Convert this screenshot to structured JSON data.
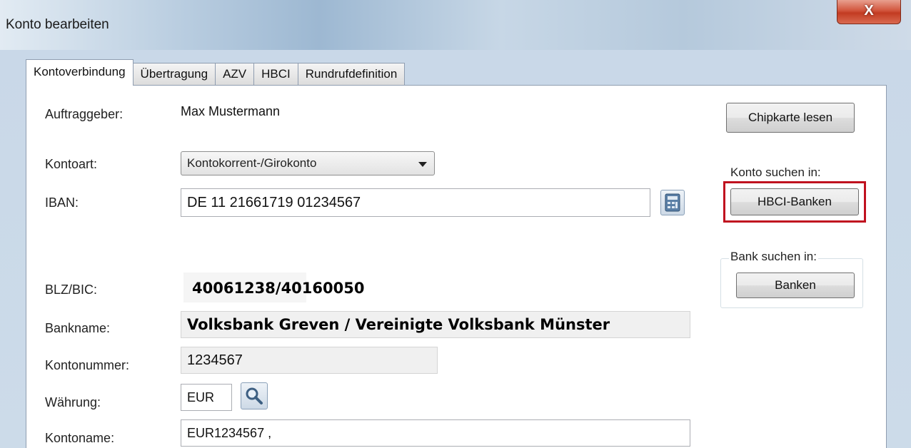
{
  "window": {
    "title": "Konto bearbeiten",
    "close_label": "X"
  },
  "tabs": [
    {
      "label": "Kontoverbindung",
      "active": true
    },
    {
      "label": "Übertragung",
      "active": false
    },
    {
      "label": "AZV",
      "active": false
    },
    {
      "label": "HBCI",
      "active": false
    },
    {
      "label": "Rundrufdefinition",
      "active": false
    }
  ],
  "form": {
    "auftraggeber_label": "Auftraggeber:",
    "auftraggeber_value": "Max Mustermann",
    "kontoart_label": "Kontoart:",
    "kontoart_value": "Kontokorrent-/Girokonto",
    "iban_label": "IBAN:",
    "iban_value": "DE 11 21661719 01234567",
    "blz_label": "BLZ/BIC:",
    "blz_value": "40061238/40160050",
    "bankname_label": "Bankname:",
    "bankname_value": "Volksbank Greven / Vereinigte Volksbank Münster",
    "kontonummer_label": "Kontonummer:",
    "kontonummer_value": "1234567",
    "waehrung_label": "Währung:",
    "waehrung_value": "EUR",
    "kontoname_label": "Kontoname:",
    "kontoname_value": "EUR1234567 ,"
  },
  "side": {
    "chipkarte_label": "Chipkarte lesen",
    "konto_suchen_label": "Konto suchen in:",
    "hbci_banken_label": "HBCI-Banken",
    "bank_suchen_label": "Bank suchen in:",
    "banken_label": "Banken"
  },
  "colors": {
    "highlight": "#c0111f",
    "close_button": "#c23b22"
  },
  "icons": {
    "iban_calc": "calculator-icon",
    "search": "magnifier-icon"
  }
}
